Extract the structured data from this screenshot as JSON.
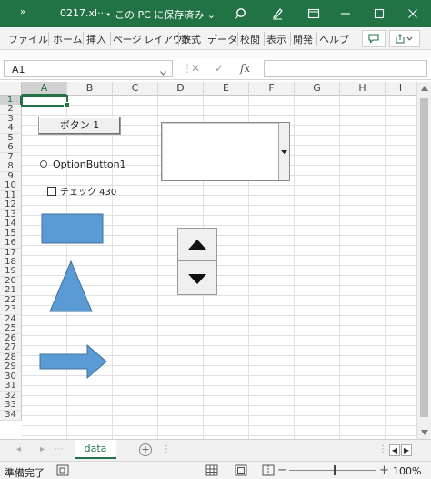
{
  "titlebar": {
    "quick_access": "»",
    "filename": "0217.xl···",
    "save_status": "• この PC に保存済み ⌄"
  },
  "ribbon": {
    "tabs": [
      "ファイル",
      "ホーム",
      "挿入",
      "ページ レイアウト",
      "数式",
      "データ",
      "校閲",
      "表示",
      "開発",
      "ヘルプ"
    ]
  },
  "formula_bar": {
    "name_box": "A1",
    "cancel": "✕",
    "enter": "✓",
    "fx": "fx",
    "formula": ""
  },
  "grid": {
    "columns": [
      "A",
      "B",
      "C",
      "D",
      "E",
      "F",
      "G",
      "H",
      "I"
    ],
    "rows": [
      "1",
      "2",
      "3",
      "4",
      "5",
      "6",
      "7",
      "8",
      "9",
      "10",
      "11",
      "12",
      "13",
      "14",
      "15",
      "16",
      "17",
      "18",
      "19",
      "20",
      "21",
      "22",
      "23",
      "24",
      "25",
      "26",
      "27",
      "28",
      "29",
      "30",
      "31",
      "32",
      "33",
      "34"
    ],
    "selected_cell": "A1"
  },
  "controls": {
    "button_label": "ボタン 1",
    "option_label": "OptionButton1",
    "checkbox_label": "チェック 430"
  },
  "colors": {
    "accent": "#217346",
    "shape_fill": "#5b9bd5",
    "shape_stroke": "#41719c"
  },
  "sheets": {
    "tabs": [
      "data"
    ],
    "add": "⊕"
  },
  "status": {
    "ready": "準備完了",
    "zoom_minus": "−",
    "zoom_plus": "+",
    "zoom": "100%"
  }
}
